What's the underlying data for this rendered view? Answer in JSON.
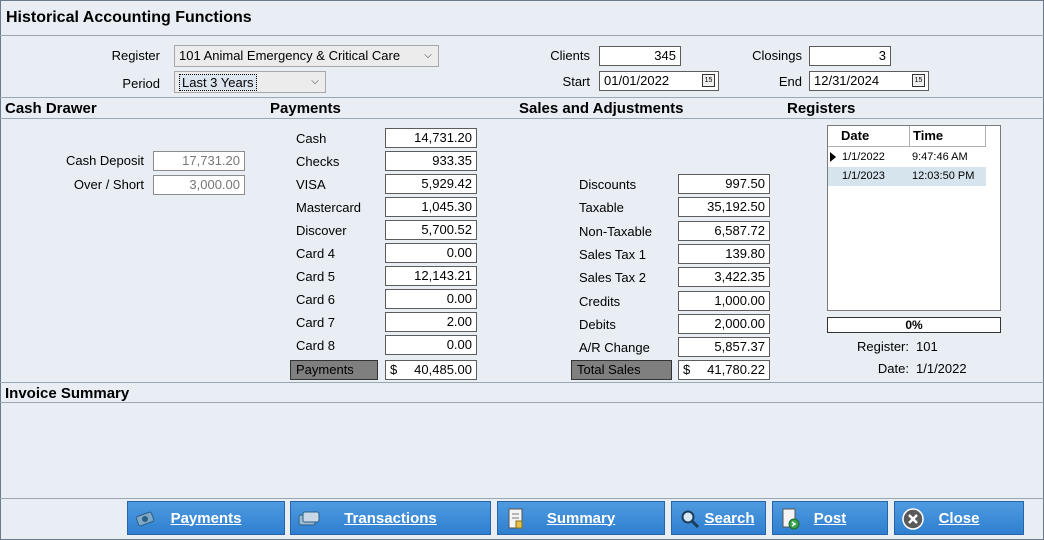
{
  "window": {
    "title": "Historical Accounting Functions"
  },
  "filters": {
    "register_label": "Register",
    "register_value": "101 Animal Emergency & Critical Care",
    "period_label": "Period",
    "period_value": "Last 3 Years",
    "clients_label": "Clients",
    "clients_value": "345",
    "closings_label": "Closings",
    "closings_value": "3",
    "start_label": "Start",
    "start_value": "01/01/2022",
    "end_label": "End",
    "end_value": "12/31/2024"
  },
  "sections": {
    "cash_drawer": "Cash Drawer",
    "payments": "Payments",
    "sales": "Sales and Adjustments",
    "registers": "Registers",
    "invoice_summary": "Invoice Summary"
  },
  "cash_drawer": {
    "deposit_label": "Cash Deposit",
    "deposit_value": "17,731.20",
    "overshort_label": "Over / Short",
    "overshort_value": "3,000.00"
  },
  "payments": {
    "items": [
      {
        "label": "Cash",
        "value": "14,731.20"
      },
      {
        "label": "Checks",
        "value": "933.35"
      },
      {
        "label": "VISA",
        "value": "5,929.42"
      },
      {
        "label": "Mastercard",
        "value": "1,045.30"
      },
      {
        "label": "Discover",
        "value": "5,700.52"
      },
      {
        "label": "Card 4",
        "value": "0.00"
      },
      {
        "label": "Card 5",
        "value": "12,143.21"
      },
      {
        "label": "Card 6",
        "value": "0.00"
      },
      {
        "label": "Card 7",
        "value": "2.00"
      },
      {
        "label": "Card 8",
        "value": "0.00"
      }
    ],
    "total_label": "Payments",
    "total_currency": "$",
    "total_value": "40,485.00"
  },
  "sales": {
    "items": [
      {
        "label": "Discounts",
        "value": "997.50"
      },
      {
        "label": "Taxable",
        "value": "35,192.50"
      },
      {
        "label": "Non-Taxable",
        "value": "6,587.72"
      },
      {
        "label": "Sales Tax 1",
        "value": "139.80"
      },
      {
        "label": "Sales Tax 2",
        "value": "3,422.35"
      },
      {
        "label": "Credits",
        "value": "1,000.00"
      },
      {
        "label": "Debits",
        "value": "2,000.00"
      },
      {
        "label": "A/R Change",
        "value": "5,857.37"
      }
    ],
    "total_label": "Total Sales",
    "total_currency": "$",
    "total_value": "41,780.22"
  },
  "registers": {
    "columns": [
      "Date",
      "Time"
    ],
    "rows": [
      {
        "date": "1/1/2022",
        "time": "9:47:46 AM"
      },
      {
        "date": "1/1/2023",
        "time": "12:03:50 PM"
      }
    ],
    "progress": 0,
    "progress_text": "0%",
    "register_label": "Register:",
    "register_value": "101",
    "date_label": "Date:",
    "date_value": "1/1/2022"
  },
  "buttons": {
    "payments": "Payments",
    "transactions": "Transactions",
    "summary": "Summary",
    "search": "Search",
    "post": "Post",
    "close": "Close"
  },
  "icons": {
    "payments": "money-icon",
    "transactions": "cards-icon",
    "summary": "document-icon",
    "search": "magnifier-icon",
    "post": "post-document-icon",
    "close": "close-circle-icon"
  }
}
